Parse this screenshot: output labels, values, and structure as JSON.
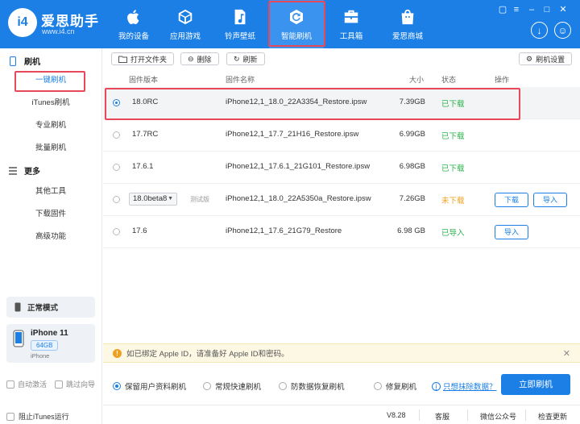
{
  "app": {
    "name": "爱思助手",
    "url": "www.i4.cn",
    "logo_text": "i4"
  },
  "nav": [
    {
      "label": "我的设备",
      "icon": "apple-icon"
    },
    {
      "label": "应用游戏",
      "icon": "cube-icon"
    },
    {
      "label": "铃声壁纸",
      "icon": "music-file-icon"
    },
    {
      "label": "智能刷机",
      "icon": "refresh-gear-icon"
    },
    {
      "label": "工具箱",
      "icon": "toolbox-icon"
    },
    {
      "label": "爱思商城",
      "icon": "shopping-bag-icon"
    }
  ],
  "sidebar": {
    "section_flash": "刷机",
    "items_flash": [
      "一键刷机",
      "iTunes刷机",
      "专业刷机",
      "批量刷机"
    ],
    "section_more": "更多",
    "items_more": [
      "其他工具",
      "下载固件",
      "高级功能"
    ],
    "mode": "正常模式",
    "device": {
      "name": "iPhone 11",
      "capacity": "64GB",
      "type": "iPhone"
    },
    "auto_activate": "自动激活",
    "skip_guide": "跳过向导",
    "block_itunes": "阻止iTunes运行"
  },
  "toolbar": {
    "open_folder": "打开文件夹",
    "delete": "删除",
    "refresh": "刷新",
    "settings": "刷机设置"
  },
  "table": {
    "headers": {
      "version": "固件版本",
      "name": "固件名称",
      "size": "大小",
      "status": "状态",
      "action": "操作"
    },
    "rows": [
      {
        "version": "18.0RC",
        "name": "iPhone12,1_18.0_22A3354_Restore.ipsw",
        "size": "7.39GB",
        "status": "已下载",
        "status_color": "#2bb24c",
        "selected": true
      },
      {
        "version": "17.7RC",
        "name": "iPhone12,1_17.7_21H16_Restore.ipsw",
        "size": "6.99GB",
        "status": "已下载",
        "status_color": "#2bb24c",
        "selected": false
      },
      {
        "version": "17.6.1",
        "name": "iPhone12,1_17.6.1_21G101_Restore.ipsw",
        "size": "6.98GB",
        "status": "已下载",
        "status_color": "#2bb24c",
        "selected": false
      },
      {
        "version": "18.0beta8",
        "tag": "测试版",
        "name": "iPhone12,1_18.0_22A5350a_Restore.ipsw",
        "size": "7.26GB",
        "status": "未下载",
        "status_color": "#f0a020",
        "selected": false,
        "download": "下载",
        "import": "导入"
      },
      {
        "version": "17.6",
        "name": "iPhone12,1_17.6_21G79_Restore",
        "size": "6.98 GB",
        "status": "已导入",
        "status_color": "#2bb24c",
        "selected": false,
        "import": "导入"
      }
    ]
  },
  "notice": "如已绑定 Apple ID，请准备好 Apple ID和密码。",
  "options": [
    "保留用户资料刷机",
    "常规快速刷机",
    "防数据恢复刷机",
    "修复刷机"
  ],
  "help_link": "只想抹除数据？",
  "flash_button": "立即刷机",
  "statusbar": {
    "version": "V8.28",
    "support": "客服",
    "wechat": "微信公众号",
    "update": "检查更新"
  },
  "colors": {
    "brand": "#1b7fe6",
    "highlight": "#e8495a",
    "ok": "#2bb24c",
    "pending": "#f0a020"
  }
}
